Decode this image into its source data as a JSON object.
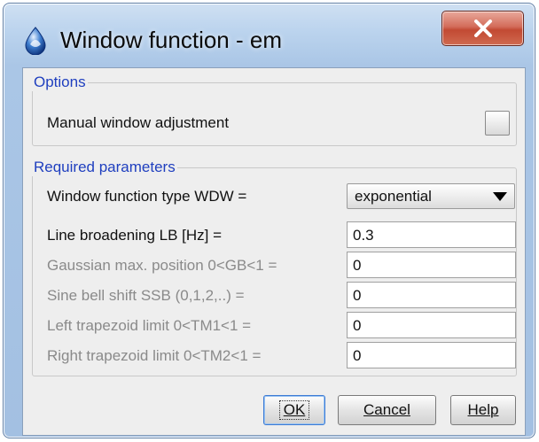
{
  "window": {
    "title": "Window function - em",
    "icon": "topspin-droplet-icon",
    "close_label": "X"
  },
  "options": {
    "title": "Options",
    "manual_adjust_label": "Manual window adjustment",
    "manual_adjust_checked": false
  },
  "required": {
    "title": "Required parameters",
    "wdw_label": "Window function type WDW =",
    "wdw_value": "exponential",
    "lb_label": "Line broadening LB [Hz] =",
    "lb_value": "0.3",
    "gb_label": "Gaussian max. position 0<GB<1 =",
    "gb_value": "0",
    "ssb_label": "Sine bell shift SSB (0,1,2,..) =",
    "ssb_value": "0",
    "tm1_label": "Left trapezoid limit 0<TM1<1 =",
    "tm1_value": "0",
    "tm2_label": "Right trapezoid limit 0<TM2<1 =",
    "tm2_value": "0"
  },
  "buttons": {
    "ok": "OK",
    "cancel": "Cancel",
    "help": "Help"
  },
  "colors": {
    "group_title": "#1f3fbf",
    "disabled_text": "#8a8a8a",
    "close_button": "#c24a33"
  }
}
